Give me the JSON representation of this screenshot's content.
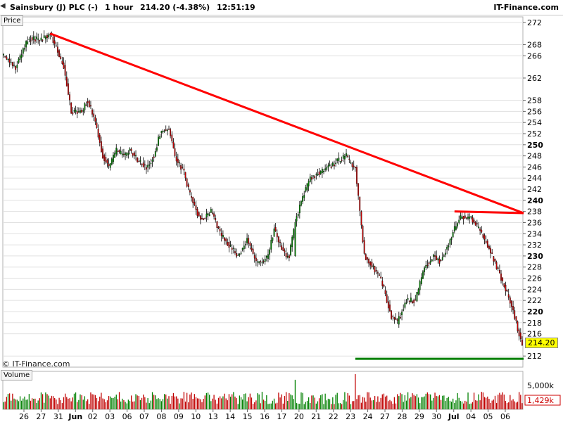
{
  "header": {
    "instrument": "Sainsbury (J) PLC (-)",
    "interval": "1 hour",
    "last": "214.20 (-4.38%)",
    "time": "12:51:19",
    "brand": "IT-Finance.com"
  },
  "panels": {
    "price": "Price",
    "volume": "Volume"
  },
  "watermark": "© IT-Finance.com",
  "current_price_label": "214.20",
  "colors": {
    "bull": "#008000",
    "bear": "#c00000",
    "trendline": "#ff0000",
    "support": "#008000",
    "grid": "#e0e0e0"
  },
  "chart_data": {
    "type": "candlestick",
    "y_range": [
      210,
      273
    ],
    "y_ticks": [
      212,
      216,
      218,
      220,
      222,
      224,
      226,
      228,
      230,
      232,
      234,
      236,
      238,
      240,
      242,
      244,
      246,
      248,
      250,
      252,
      254,
      256,
      258,
      262,
      266,
      268,
      272
    ],
    "y_tick_labels": [
      "212",
      "216",
      "218",
      "220",
      "222",
      "224",
      "226",
      "228",
      "230",
      "232",
      "234",
      "236",
      "238",
      "240",
      "242",
      "244",
      "246",
      "248",
      "250",
      "252",
      "254",
      "256",
      "258",
      "262",
      "266",
      "268",
      "272"
    ],
    "x_ticks": [
      "26",
      "27",
      "31",
      "Jun",
      "02",
      "03",
      "06",
      "07",
      "08",
      "09",
      "10",
      "13",
      "14",
      "15",
      "16",
      "17",
      "20",
      "21",
      "22",
      "23",
      "24",
      "27",
      "28",
      "29",
      "30",
      "Jul",
      "04",
      "05",
      "06"
    ],
    "anchors": [
      [
        0,
        266
      ],
      [
        8,
        264
      ],
      [
        16,
        269
      ],
      [
        26,
        269
      ],
      [
        31,
        270
      ],
      [
        34,
        268
      ],
      [
        40,
        264
      ],
      [
        45,
        256
      ],
      [
        52,
        256
      ],
      [
        56,
        258
      ],
      [
        60,
        255
      ],
      [
        66,
        248
      ],
      [
        70,
        246
      ],
      [
        75,
        249
      ],
      [
        80,
        248
      ],
      [
        84,
        249
      ],
      [
        90,
        247
      ],
      [
        95,
        246
      ],
      [
        100,
        248
      ],
      [
        104,
        252
      ],
      [
        110,
        253
      ],
      [
        114,
        248
      ],
      [
        120,
        245
      ],
      [
        124,
        241
      ],
      [
        130,
        237
      ],
      [
        134,
        237
      ],
      [
        138,
        238
      ],
      [
        144,
        234
      ],
      [
        150,
        232
      ],
      [
        156,
        230
      ],
      [
        162,
        233
      ],
      [
        168,
        229
      ],
      [
        172,
        229
      ],
      [
        176,
        230
      ],
      [
        180,
        235
      ],
      [
        184,
        232
      ],
      [
        188,
        230
      ],
      [
        190,
        230
      ],
      [
        194,
        236
      ],
      [
        198,
        240
      ],
      [
        204,
        244
      ],
      [
        210,
        245
      ],
      [
        216,
        246
      ],
      [
        222,
        247
      ],
      [
        228,
        248
      ],
      [
        232,
        246
      ],
      [
        234,
        246
      ],
      [
        240,
        230
      ],
      [
        246,
        228
      ],
      [
        252,
        225
      ],
      [
        258,
        219
      ],
      [
        262,
        218
      ],
      [
        268,
        222
      ],
      [
        274,
        222
      ],
      [
        280,
        228
      ],
      [
        286,
        230
      ],
      [
        290,
        229
      ],
      [
        296,
        232
      ],
      [
        300,
        235
      ],
      [
        304,
        237
      ],
      [
        310,
        237
      ],
      [
        316,
        235
      ],
      [
        322,
        232
      ],
      [
        328,
        228
      ],
      [
        334,
        224
      ],
      [
        338,
        221
      ],
      [
        342,
        217
      ],
      [
        345,
        214
      ]
    ],
    "gaps": [
      [
        190,
        194
      ],
      [
        232,
        234
      ]
    ],
    "trendlines": [
      {
        "from": [
          31,
          270.0
        ],
        "to": [
          346,
          237.7
        ],
        "color": "#ff0000"
      },
      {
        "from": [
          300,
          238.0
        ],
        "to": [
          346,
          237.7
        ],
        "color": "#ff0000"
      },
      {
        "from": [
          234,
          211.5
        ],
        "to": [
          346,
          211.5
        ],
        "color": "#008000"
      }
    ],
    "volume_axis": {
      "labels": [
        "5,000k"
      ],
      "last": "1,429k"
    },
    "grid": true
  }
}
